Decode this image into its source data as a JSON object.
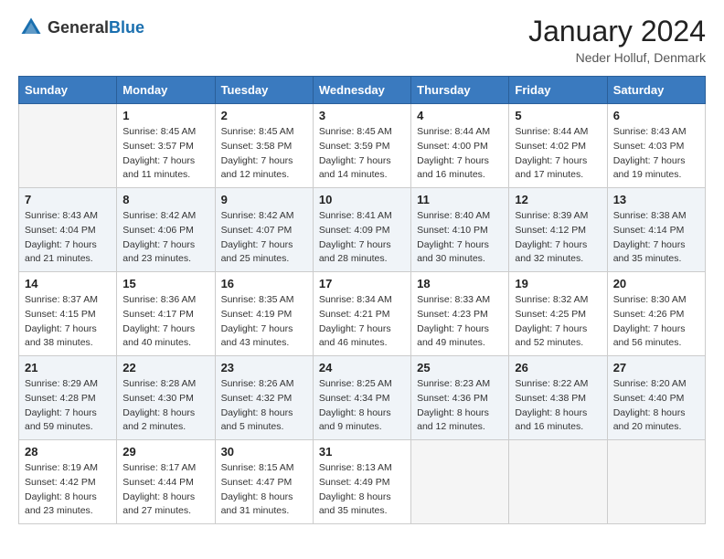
{
  "header": {
    "logo_general": "General",
    "logo_blue": "Blue",
    "month": "January 2024",
    "location": "Neder Holluf, Denmark"
  },
  "days_of_week": [
    "Sunday",
    "Monday",
    "Tuesday",
    "Wednesday",
    "Thursday",
    "Friday",
    "Saturday"
  ],
  "weeks": [
    [
      {
        "day": "",
        "empty": true
      },
      {
        "day": "1",
        "sunrise": "Sunrise: 8:45 AM",
        "sunset": "Sunset: 3:57 PM",
        "daylight": "Daylight: 7 hours and 11 minutes."
      },
      {
        "day": "2",
        "sunrise": "Sunrise: 8:45 AM",
        "sunset": "Sunset: 3:58 PM",
        "daylight": "Daylight: 7 hours and 12 minutes."
      },
      {
        "day": "3",
        "sunrise": "Sunrise: 8:45 AM",
        "sunset": "Sunset: 3:59 PM",
        "daylight": "Daylight: 7 hours and 14 minutes."
      },
      {
        "day": "4",
        "sunrise": "Sunrise: 8:44 AM",
        "sunset": "Sunset: 4:00 PM",
        "daylight": "Daylight: 7 hours and 16 minutes."
      },
      {
        "day": "5",
        "sunrise": "Sunrise: 8:44 AM",
        "sunset": "Sunset: 4:02 PM",
        "daylight": "Daylight: 7 hours and 17 minutes."
      },
      {
        "day": "6",
        "sunrise": "Sunrise: 8:43 AM",
        "sunset": "Sunset: 4:03 PM",
        "daylight": "Daylight: 7 hours and 19 minutes."
      }
    ],
    [
      {
        "day": "7",
        "sunrise": "Sunrise: 8:43 AM",
        "sunset": "Sunset: 4:04 PM",
        "daylight": "Daylight: 7 hours and 21 minutes."
      },
      {
        "day": "8",
        "sunrise": "Sunrise: 8:42 AM",
        "sunset": "Sunset: 4:06 PM",
        "daylight": "Daylight: 7 hours and 23 minutes."
      },
      {
        "day": "9",
        "sunrise": "Sunrise: 8:42 AM",
        "sunset": "Sunset: 4:07 PM",
        "daylight": "Daylight: 7 hours and 25 minutes."
      },
      {
        "day": "10",
        "sunrise": "Sunrise: 8:41 AM",
        "sunset": "Sunset: 4:09 PM",
        "daylight": "Daylight: 7 hours and 28 minutes."
      },
      {
        "day": "11",
        "sunrise": "Sunrise: 8:40 AM",
        "sunset": "Sunset: 4:10 PM",
        "daylight": "Daylight: 7 hours and 30 minutes."
      },
      {
        "day": "12",
        "sunrise": "Sunrise: 8:39 AM",
        "sunset": "Sunset: 4:12 PM",
        "daylight": "Daylight: 7 hours and 32 minutes."
      },
      {
        "day": "13",
        "sunrise": "Sunrise: 8:38 AM",
        "sunset": "Sunset: 4:14 PM",
        "daylight": "Daylight: 7 hours and 35 minutes."
      }
    ],
    [
      {
        "day": "14",
        "sunrise": "Sunrise: 8:37 AM",
        "sunset": "Sunset: 4:15 PM",
        "daylight": "Daylight: 7 hours and 38 minutes."
      },
      {
        "day": "15",
        "sunrise": "Sunrise: 8:36 AM",
        "sunset": "Sunset: 4:17 PM",
        "daylight": "Daylight: 7 hours and 40 minutes."
      },
      {
        "day": "16",
        "sunrise": "Sunrise: 8:35 AM",
        "sunset": "Sunset: 4:19 PM",
        "daylight": "Daylight: 7 hours and 43 minutes."
      },
      {
        "day": "17",
        "sunrise": "Sunrise: 8:34 AM",
        "sunset": "Sunset: 4:21 PM",
        "daylight": "Daylight: 7 hours and 46 minutes."
      },
      {
        "day": "18",
        "sunrise": "Sunrise: 8:33 AM",
        "sunset": "Sunset: 4:23 PM",
        "daylight": "Daylight: 7 hours and 49 minutes."
      },
      {
        "day": "19",
        "sunrise": "Sunrise: 8:32 AM",
        "sunset": "Sunset: 4:25 PM",
        "daylight": "Daylight: 7 hours and 52 minutes."
      },
      {
        "day": "20",
        "sunrise": "Sunrise: 8:30 AM",
        "sunset": "Sunset: 4:26 PM",
        "daylight": "Daylight: 7 hours and 56 minutes."
      }
    ],
    [
      {
        "day": "21",
        "sunrise": "Sunrise: 8:29 AM",
        "sunset": "Sunset: 4:28 PM",
        "daylight": "Daylight: 7 hours and 59 minutes."
      },
      {
        "day": "22",
        "sunrise": "Sunrise: 8:28 AM",
        "sunset": "Sunset: 4:30 PM",
        "daylight": "Daylight: 8 hours and 2 minutes."
      },
      {
        "day": "23",
        "sunrise": "Sunrise: 8:26 AM",
        "sunset": "Sunset: 4:32 PM",
        "daylight": "Daylight: 8 hours and 5 minutes."
      },
      {
        "day": "24",
        "sunrise": "Sunrise: 8:25 AM",
        "sunset": "Sunset: 4:34 PM",
        "daylight": "Daylight: 8 hours and 9 minutes."
      },
      {
        "day": "25",
        "sunrise": "Sunrise: 8:23 AM",
        "sunset": "Sunset: 4:36 PM",
        "daylight": "Daylight: 8 hours and 12 minutes."
      },
      {
        "day": "26",
        "sunrise": "Sunrise: 8:22 AM",
        "sunset": "Sunset: 4:38 PM",
        "daylight": "Daylight: 8 hours and 16 minutes."
      },
      {
        "day": "27",
        "sunrise": "Sunrise: 8:20 AM",
        "sunset": "Sunset: 4:40 PM",
        "daylight": "Daylight: 8 hours and 20 minutes."
      }
    ],
    [
      {
        "day": "28",
        "sunrise": "Sunrise: 8:19 AM",
        "sunset": "Sunset: 4:42 PM",
        "daylight": "Daylight: 8 hours and 23 minutes."
      },
      {
        "day": "29",
        "sunrise": "Sunrise: 8:17 AM",
        "sunset": "Sunset: 4:44 PM",
        "daylight": "Daylight: 8 hours and 27 minutes."
      },
      {
        "day": "30",
        "sunrise": "Sunrise: 8:15 AM",
        "sunset": "Sunset: 4:47 PM",
        "daylight": "Daylight: 8 hours and 31 minutes."
      },
      {
        "day": "31",
        "sunrise": "Sunrise: 8:13 AM",
        "sunset": "Sunset: 4:49 PM",
        "daylight": "Daylight: 8 hours and 35 minutes."
      },
      {
        "day": "",
        "empty": true
      },
      {
        "day": "",
        "empty": true
      },
      {
        "day": "",
        "empty": true
      }
    ]
  ]
}
